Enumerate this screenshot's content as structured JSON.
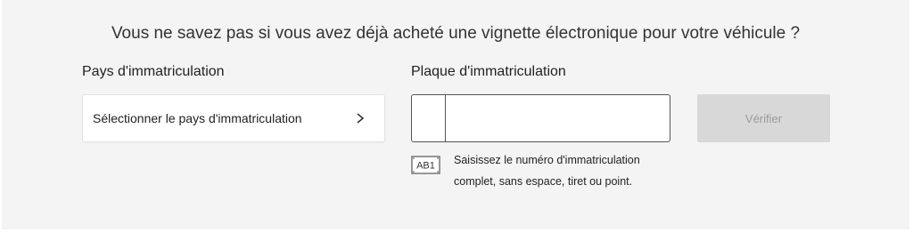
{
  "heading": "Vous ne savez pas si vous avez déjà acheté une vignette électronique pour votre véhicule ?",
  "country": {
    "label": "Pays d'immatriculation",
    "select_text": "Sélectionner le pays d'immatriculation",
    "icon": "chevron-right-icon"
  },
  "plate": {
    "label": "Plaque d'immatriculation",
    "value": "",
    "placeholder": "",
    "icon": "license-plate-icon",
    "icon_text": "AB1",
    "hint_line1": "Saisissez le numéro d'immatriculation",
    "hint_line2": "complet, sans espace, tiret ou point."
  },
  "verify_button": {
    "label": "Vérifier",
    "state": "disabled"
  },
  "colors": {
    "panel_bg": "#f4f4f4",
    "button_disabled_bg": "#d8d8d8",
    "button_disabled_text": "#9a9a9a",
    "input_border": "#555555"
  }
}
